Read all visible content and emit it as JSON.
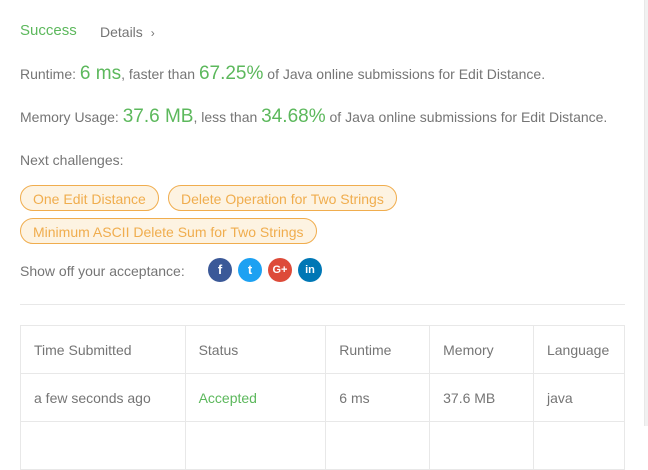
{
  "header": {
    "status": "Success",
    "details_label": "Details",
    "details_chevron": "›"
  },
  "runtime": {
    "label": "Runtime: ",
    "value": "6 ms",
    "faster_text": ", faster than ",
    "percent": "67.25%",
    "suffix": " of Java online submissions for Edit Distance."
  },
  "memory": {
    "label": "Memory Usage: ",
    "value": "37.6 MB",
    "less_text": ", less than ",
    "percent": "34.68%",
    "suffix": " of Java online submissions for Edit Distance."
  },
  "next": {
    "label": "Next challenges:",
    "challenges": [
      "One Edit Distance",
      "Delete Operation for Two Strings",
      "Minimum ASCII Delete Sum for Two Strings"
    ]
  },
  "share": {
    "label": "Show off your acceptance:",
    "icons": [
      "facebook-icon",
      "twitter-icon",
      "google-plus-icon",
      "linkedin-icon"
    ],
    "glyphs": {
      "facebook": "f",
      "twitter": "t",
      "google": "G+",
      "linkedin": "in"
    }
  },
  "table": {
    "headers": [
      "Time Submitted",
      "Status",
      "Runtime",
      "Memory",
      "Language"
    ],
    "rows": [
      [
        "a few seconds ago",
        "Accepted",
        "6 ms",
        "37.6 MB",
        "java"
      ]
    ]
  },
  "colors": {
    "success": "#5cb85c",
    "accent": "#f0ad4e",
    "text": "#757575"
  }
}
